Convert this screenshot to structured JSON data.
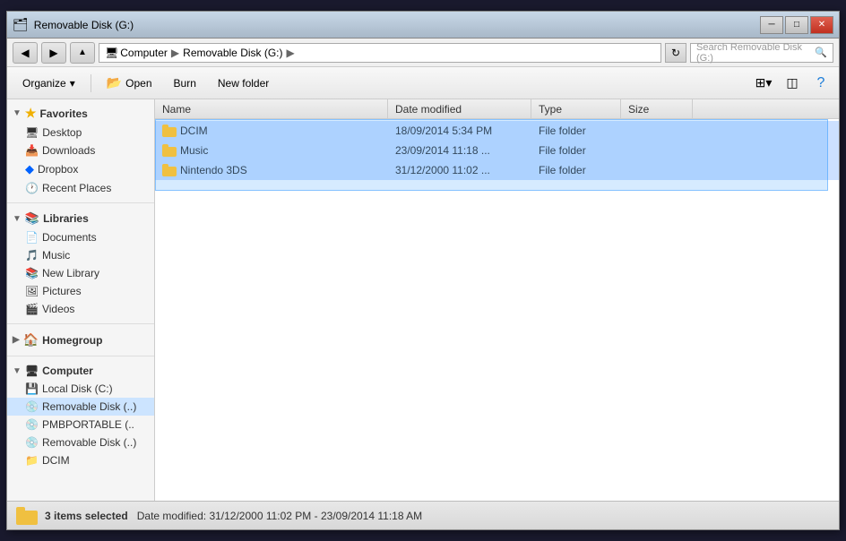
{
  "window": {
    "title": "Removable Disk (G:)",
    "titlebar": "Removable Disk (G:)"
  },
  "addressbar": {
    "crumbs": [
      "Computer",
      "Removable Disk (G:)"
    ],
    "search_placeholder": "Search Removable Disk (G:)"
  },
  "toolbar": {
    "organize_label": "Organize",
    "organize_arrow": "▾",
    "open_label": "Open",
    "burn_label": "Burn",
    "new_folder_label": "New folder"
  },
  "columns": {
    "name": "Name",
    "date_modified": "Date modified",
    "type": "Type",
    "size": "Size"
  },
  "files": [
    {
      "name": "DCIM",
      "date_modified": "18/09/2014 5:34 PM",
      "type": "File folder",
      "size": "",
      "selected": true
    },
    {
      "name": "Music",
      "date_modified": "23/09/2014 11:18 ...",
      "type": "File folder",
      "size": "",
      "selected": true
    },
    {
      "name": "Nintendo 3DS",
      "date_modified": "31/12/2000 11:02 ...",
      "type": "File folder",
      "size": "",
      "selected": true
    }
  ],
  "sidebar": {
    "favorites": {
      "label": "Favorites",
      "items": [
        {
          "label": "Desktop",
          "icon": "desktop"
        },
        {
          "label": "Downloads",
          "icon": "downloads"
        },
        {
          "label": "Dropbox",
          "icon": "dropbox"
        },
        {
          "label": "Recent Places",
          "icon": "recent"
        }
      ]
    },
    "libraries": {
      "label": "Libraries",
      "items": [
        {
          "label": "Documents",
          "icon": "documents"
        },
        {
          "label": "Music",
          "icon": "music"
        },
        {
          "label": "New Library",
          "icon": "library"
        },
        {
          "label": "Pictures",
          "icon": "pictures"
        },
        {
          "label": "Videos",
          "icon": "videos"
        }
      ]
    },
    "homegroup": {
      "label": "Homegroup"
    },
    "computer": {
      "label": "Computer",
      "items": [
        {
          "label": "Local Disk (C:)",
          "icon": "disk"
        },
        {
          "label": "Removable Disk (..)",
          "icon": "removable",
          "active": true
        },
        {
          "label": "PMBPORTABLE (..",
          "icon": "removable"
        },
        {
          "label": "Removable Disk (..)",
          "icon": "removable"
        }
      ]
    },
    "dcim_sub": {
      "label": "DCIM"
    }
  },
  "statusbar": {
    "count_label": "3 items selected",
    "date_range_label": "Date modified: 31/12/2000 11:02 PM - 23/09/2014 11:18 AM"
  },
  "titlebar_buttons": {
    "minimize": "─",
    "maximize": "□",
    "close": "✕"
  }
}
